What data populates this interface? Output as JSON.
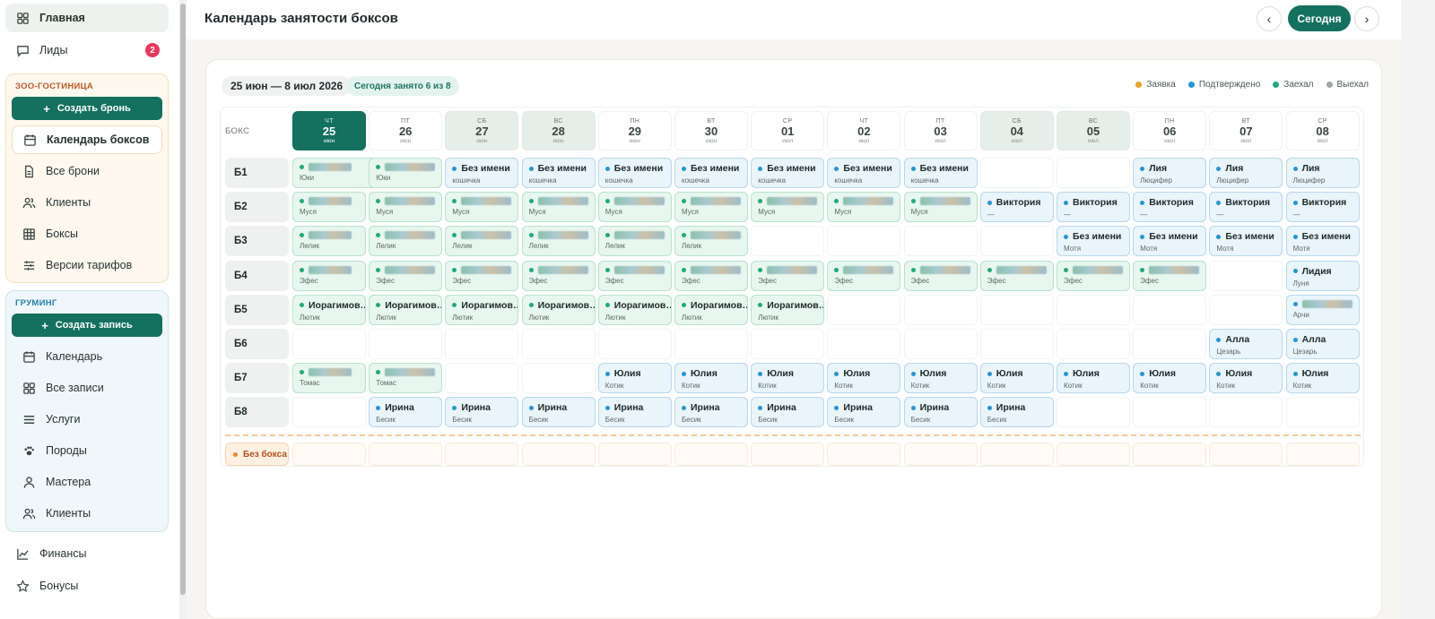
{
  "sidebar": {
    "top_items": [
      {
        "label": "Главная",
        "icon": "grid-icon",
        "active": true
      },
      {
        "label": "Лиды",
        "icon": "chat-icon",
        "badge": "2"
      }
    ],
    "zoo": {
      "title": "ЗОО-ГОСТИНИЦА",
      "create_label": "Создать бронь",
      "items": [
        {
          "label": "Календарь боксов",
          "icon": "calendar-icon",
          "active": true
        },
        {
          "label": "Все брони",
          "icon": "document-icon"
        },
        {
          "label": "Клиенты",
          "icon": "users-icon"
        },
        {
          "label": "Боксы",
          "icon": "table-grid-icon"
        },
        {
          "label": "Версии тарифов",
          "icon": "sliders-icon"
        }
      ]
    },
    "grooming": {
      "title": "ГРУМИНГ",
      "create_label": "Создать запись",
      "items": [
        {
          "label": "Календарь",
          "icon": "calendar-icon"
        },
        {
          "label": "Все записи",
          "icon": "grid-icon"
        },
        {
          "label": "Услуги",
          "icon": "list-icon"
        },
        {
          "label": "Породы",
          "icon": "paw-icon"
        },
        {
          "label": "Мастера",
          "icon": "user-icon"
        },
        {
          "label": "Клиенты",
          "icon": "users-icon"
        }
      ]
    },
    "bottom_items": [
      {
        "label": "Финансы",
        "icon": "chart-line-icon"
      },
      {
        "label": "Бонусы",
        "icon": "star-icon"
      }
    ]
  },
  "header": {
    "title": "Календарь занятости боксов",
    "prev_label": "‹",
    "today_label": "Сегодня",
    "next_label": "›"
  },
  "calendar": {
    "range": "25 июн — 8 июл 2026",
    "occupancy": "Сегодня занято 6 из 8",
    "legend": [
      {
        "label": "Заявка",
        "color": "#f0a020"
      },
      {
        "label": "Подтверждено",
        "color": "#2496d4"
      },
      {
        "label": "Заехал",
        "color": "#1faa78"
      },
      {
        "label": "Выехал",
        "color": "#a0a6a4"
      }
    ],
    "box_header": "БОКС",
    "days": [
      {
        "dow": "ЧТ",
        "num": "25",
        "mon": "июн",
        "today": true
      },
      {
        "dow": "ПТ",
        "num": "26",
        "mon": "июн"
      },
      {
        "dow": "СБ",
        "num": "27",
        "mon": "июн",
        "weekend": true
      },
      {
        "dow": "ВС",
        "num": "28",
        "mon": "июн",
        "weekend": true
      },
      {
        "dow": "ПН",
        "num": "29",
        "mon": "июн"
      },
      {
        "dow": "ВТ",
        "num": "30",
        "mon": "июн"
      },
      {
        "dow": "СР",
        "num": "01",
        "mon": "июл"
      },
      {
        "dow": "ЧТ",
        "num": "02",
        "mon": "июл"
      },
      {
        "dow": "ПТ",
        "num": "03",
        "mon": "июл"
      },
      {
        "dow": "СБ",
        "num": "04",
        "mon": "июл",
        "weekend": true
      },
      {
        "dow": "ВС",
        "num": "05",
        "mon": "июл",
        "weekend": true
      },
      {
        "dow": "ПН",
        "num": "06",
        "mon": "июл"
      },
      {
        "dow": "ВТ",
        "num": "07",
        "mon": "июл"
      },
      {
        "dow": "СР",
        "num": "08",
        "mon": "июл"
      }
    ],
    "boxes": [
      {
        "label": "Б1",
        "bookings": [
          {
            "start": 0,
            "end": 1,
            "name": "",
            "pet": "Юки",
            "status": "checked_in",
            "redacted": true
          },
          {
            "start": 1,
            "end": 1,
            "name": "",
            "pet": "Юки",
            "status": "checked_in",
            "redacted": true
          },
          {
            "start": 2,
            "end": 2,
            "name": "Без имени",
            "pet": "кошечка",
            "status": "confirmed"
          },
          {
            "start": 3,
            "end": 3,
            "name": "Без имени",
            "pet": "кошечка",
            "status": "confirmed"
          },
          {
            "start": 4,
            "end": 4,
            "name": "Без имени",
            "pet": "кошечка",
            "status": "confirmed"
          },
          {
            "start": 5,
            "end": 5,
            "name": "Без имени",
            "pet": "кошечка",
            "status": "confirmed"
          },
          {
            "start": 6,
            "end": 6,
            "name": "Без имени",
            "pet": "кошечка",
            "status": "confirmed"
          },
          {
            "start": 7,
            "end": 7,
            "name": "Без имени",
            "pet": "кошечка",
            "status": "confirmed"
          },
          {
            "start": 8,
            "end": 8,
            "name": "Без имени",
            "pet": "кошечка",
            "status": "confirmed"
          },
          {
            "start": 11,
            "end": 11,
            "name": "Лия",
            "pet": "Люцифер",
            "status": "confirmed"
          },
          {
            "start": 12,
            "end": 12,
            "name": "Лия",
            "pet": "Люцифер",
            "status": "confirmed"
          },
          {
            "start": 13,
            "end": 13,
            "name": "Лия",
            "pet": "Люцифер",
            "status": "confirmed"
          }
        ]
      },
      {
        "label": "Б2",
        "bookings": [
          {
            "start": 0,
            "end": 0,
            "name": "",
            "pet": "Муся",
            "status": "checked_in",
            "redacted": true
          },
          {
            "start": 1,
            "end": 1,
            "name": "",
            "pet": "Муся",
            "status": "checked_in",
            "redacted": true
          },
          {
            "start": 2,
            "end": 2,
            "name": "",
            "pet": "Муся",
            "status": "checked_in",
            "redacted": true
          },
          {
            "start": 3,
            "end": 3,
            "name": "",
            "pet": "Муся",
            "status": "checked_in",
            "redacted": true
          },
          {
            "start": 4,
            "end": 4,
            "name": "",
            "pet": "Муся",
            "status": "checked_in",
            "redacted": true
          },
          {
            "start": 5,
            "end": 5,
            "name": "",
            "pet": "Муся",
            "status": "checked_in",
            "redacted": true
          },
          {
            "start": 6,
            "end": 6,
            "name": "",
            "pet": "Муся",
            "status": "checked_in",
            "redacted": true
          },
          {
            "start": 7,
            "end": 7,
            "name": "",
            "pet": "Муся",
            "status": "checked_in",
            "redacted": true
          },
          {
            "start": 8,
            "end": 8,
            "name": "",
            "pet": "Муся",
            "status": "checked_in",
            "redacted": true
          },
          {
            "start": 9,
            "end": 9,
            "name": "Виктория",
            "pet": "—",
            "status": "confirmed"
          },
          {
            "start": 10,
            "end": 10,
            "name": "Виктория",
            "pet": "—",
            "status": "confirmed"
          },
          {
            "start": 11,
            "end": 11,
            "name": "Виктория",
            "pet": "—",
            "status": "confirmed"
          },
          {
            "start": 12,
            "end": 12,
            "name": "Виктория",
            "pet": "—",
            "status": "confirmed"
          },
          {
            "start": 13,
            "end": 13,
            "name": "Виктория",
            "pet": "—",
            "status": "confirmed"
          }
        ]
      },
      {
        "label": "Б3",
        "bookings": [
          {
            "start": 0,
            "end": 0,
            "name": "",
            "pet": "Лелик",
            "status": "checked_in",
            "redacted": true
          },
          {
            "start": 1,
            "end": 1,
            "name": "",
            "pet": "Лелик",
            "status": "checked_in",
            "redacted": true
          },
          {
            "start": 2,
            "end": 2,
            "name": "",
            "pet": "Лелик",
            "status": "checked_in",
            "redacted": true
          },
          {
            "start": 3,
            "end": 3,
            "name": "",
            "pet": "Лелик",
            "status": "checked_in",
            "redacted": true
          },
          {
            "start": 4,
            "end": 4,
            "name": "",
            "pet": "Лелик",
            "status": "checked_in",
            "redacted": true
          },
          {
            "start": 5,
            "end": 5,
            "name": "",
            "pet": "Лелик",
            "status": "checked_in",
            "redacted": true
          },
          {
            "start": 10,
            "end": 10,
            "name": "Без имени",
            "pet": "Мотя",
            "status": "confirmed"
          },
          {
            "start": 11,
            "end": 11,
            "name": "Без имени",
            "pet": "Мотя",
            "status": "confirmed"
          },
          {
            "start": 12,
            "end": 12,
            "name": "Без имени",
            "pet": "Мотя",
            "status": "confirmed"
          },
          {
            "start": 13,
            "end": 13,
            "name": "Без имени",
            "pet": "Мотя",
            "status": "confirmed"
          }
        ]
      },
      {
        "label": "Б4",
        "bookings": [
          {
            "start": 0,
            "end": 0,
            "name": "",
            "pet": "Эфес",
            "status": "checked_in",
            "redacted": true
          },
          {
            "start": 1,
            "end": 1,
            "name": "",
            "pet": "Эфес",
            "status": "checked_in",
            "redacted": true
          },
          {
            "start": 2,
            "end": 2,
            "name": "",
            "pet": "Эфес",
            "status": "checked_in",
            "redacted": true
          },
          {
            "start": 3,
            "end": 3,
            "name": "",
            "pet": "Эфес",
            "status": "checked_in",
            "redacted": true
          },
          {
            "start": 4,
            "end": 4,
            "name": "",
            "pet": "Эфес",
            "status": "checked_in",
            "redacted": true
          },
          {
            "start": 5,
            "end": 5,
            "name": "",
            "pet": "Эфес",
            "status": "checked_in",
            "redacted": true
          },
          {
            "start": 6,
            "end": 6,
            "name": "",
            "pet": "Эфес",
            "status": "checked_in",
            "redacted": true
          },
          {
            "start": 7,
            "end": 7,
            "name": "",
            "pet": "Эфес",
            "status": "checked_in",
            "redacted": true
          },
          {
            "start": 8,
            "end": 8,
            "name": "",
            "pet": "Эфес",
            "status": "checked_in",
            "redacted": true
          },
          {
            "start": 9,
            "end": 9,
            "name": "",
            "pet": "Эфес",
            "status": "checked_in",
            "redacted": true
          },
          {
            "start": 10,
            "end": 10,
            "name": "",
            "pet": "Эфес",
            "status": "checked_in",
            "redacted": true
          },
          {
            "start": 11,
            "end": 11,
            "name": "",
            "pet": "Эфес",
            "status": "checked_in",
            "redacted": true
          },
          {
            "start": 13,
            "end": 13,
            "name": "Лидия",
            "pet": "Луня",
            "status": "confirmed"
          }
        ]
      },
      {
        "label": "Б5",
        "bookings": [
          {
            "start": 0,
            "end": 0,
            "name": "Иорагимов…",
            "pet": "Лютик",
            "status": "checked_in"
          },
          {
            "start": 1,
            "end": 1,
            "name": "Иорагимов…",
            "pet": "Лютик",
            "status": "checked_in"
          },
          {
            "start": 2,
            "end": 2,
            "name": "Иорагимов…",
            "pet": "Лютик",
            "status": "checked_in"
          },
          {
            "start": 3,
            "end": 3,
            "name": "Иорагимов…",
            "pet": "Лютик",
            "status": "checked_in"
          },
          {
            "start": 4,
            "end": 4,
            "name": "Иорагимов…",
            "pet": "Лютик",
            "status": "checked_in"
          },
          {
            "start": 5,
            "end": 5,
            "name": "Иорагимов…",
            "pet": "Лютик",
            "status": "checked_in"
          },
          {
            "start": 6,
            "end": 6,
            "name": "Иорагимов…",
            "pet": "Лютик",
            "status": "checked_in"
          },
          {
            "start": 13,
            "end": 13,
            "name": "",
            "pet": "Арчи",
            "status": "confirmed",
            "redacted": true
          }
        ]
      },
      {
        "label": "Б6",
        "bookings": [
          {
            "start": 12,
            "end": 12,
            "name": "Алла",
            "pet": "Цезарь",
            "status": "confirmed"
          },
          {
            "start": 13,
            "end": 13,
            "name": "Алла",
            "pet": "Цезарь",
            "status": "confirmed"
          }
        ]
      },
      {
        "label": "Б7",
        "bookings": [
          {
            "start": 0,
            "end": 0,
            "name": "",
            "pet": "Томас",
            "status": "checked_in",
            "redacted": true
          },
          {
            "start": 1,
            "end": 1,
            "name": "",
            "pet": "Томас",
            "status": "checked_in",
            "redacted": true
          },
          {
            "start": 4,
            "end": 4,
            "name": "Юлия",
            "pet": "Котик",
            "status": "confirmed"
          },
          {
            "start": 5,
            "end": 5,
            "name": "Юлия",
            "pet": "Котик",
            "status": "confirmed"
          },
          {
            "start": 6,
            "end": 6,
            "name": "Юлия",
            "pet": "Котик",
            "status": "confirmed"
          },
          {
            "start": 7,
            "end": 7,
            "name": "Юлия",
            "pet": "Котик",
            "status": "confirmed"
          },
          {
            "start": 8,
            "end": 8,
            "name": "Юлия",
            "pet": "Котик",
            "status": "confirmed"
          },
          {
            "start": 9,
            "end": 9,
            "name": "Юлия",
            "pet": "Котик",
            "status": "confirmed"
          },
          {
            "start": 10,
            "end": 10,
            "name": "Юлия",
            "pet": "Котик",
            "status": "confirmed"
          },
          {
            "start": 11,
            "end": 11,
            "name": "Юлия",
            "pet": "Котик",
            "status": "confirmed"
          },
          {
            "start": 12,
            "end": 12,
            "name": "Юлия",
            "pet": "Котик",
            "status": "confirmed"
          },
          {
            "start": 13,
            "end": 13,
            "name": "Юлия",
            "pet": "Котик",
            "status": "confirmed"
          }
        ]
      },
      {
        "label": "Б8",
        "bookings": [
          {
            "start": 1,
            "end": 1,
            "name": "Ирина",
            "pet": "Бесик",
            "status": "confirmed"
          },
          {
            "start": 2,
            "end": 2,
            "name": "Ирина",
            "pet": "Бесик",
            "status": "confirmed"
          },
          {
            "start": 3,
            "end": 3,
            "name": "Ирина",
            "pet": "Бесик",
            "status": "confirmed"
          },
          {
            "start": 4,
            "end": 4,
            "name": "Ирина",
            "pet": "Бесик",
            "status": "confirmed"
          },
          {
            "start": 5,
            "end": 5,
            "name": "Ирина",
            "pet": "Бесик",
            "status": "confirmed"
          },
          {
            "start": 6,
            "end": 6,
            "name": "Ирина",
            "pet": "Бесик",
            "status": "confirmed"
          },
          {
            "start": 7,
            "end": 7,
            "name": "Ирина",
            "pet": "Бесик",
            "status": "confirmed"
          },
          {
            "start": 8,
            "end": 8,
            "name": "Ирина",
            "pet": "Бесик",
            "status": "confirmed"
          },
          {
            "start": 9,
            "end": 9,
            "name": "Ирина",
            "pet": "Бесик",
            "status": "confirmed"
          }
        ]
      }
    ],
    "no_box_label": "Без бокса"
  }
}
